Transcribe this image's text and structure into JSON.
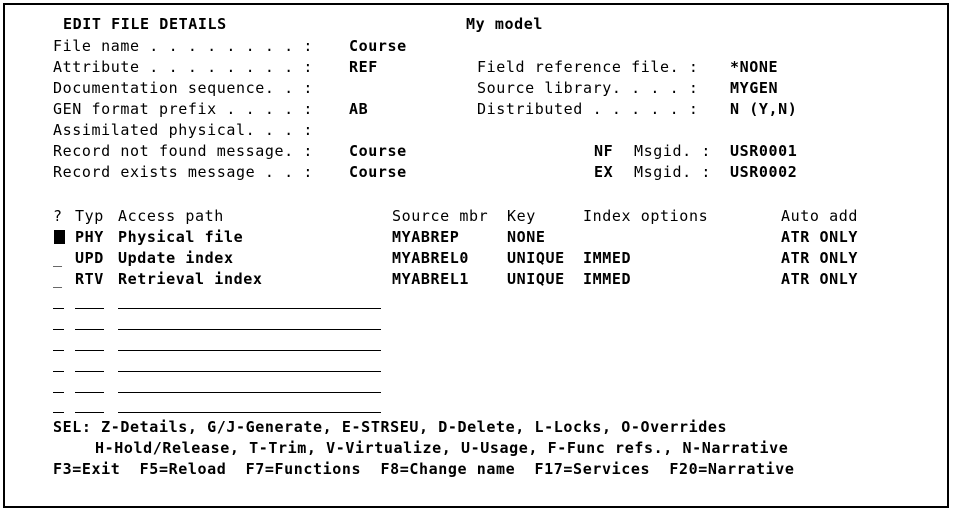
{
  "header": {
    "title": "EDIT FILE DETAILS",
    "model": "My model"
  },
  "fields": {
    "file_name": {
      "label": "File name . . . . . . . . :",
      "value": "Course"
    },
    "attribute": {
      "label": "Attribute . . . . . . . . :",
      "value": "REF"
    },
    "documentation_sequence": {
      "label": "Documentation sequence. . :",
      "value": ""
    },
    "gen_format_prefix": {
      "label": "GEN format prefix . . . . :",
      "value": "AB"
    },
    "assimilated_physical": {
      "label": "Assimilated physical. . . :",
      "value": ""
    },
    "record_not_found": {
      "label": "Record not found message. :",
      "value": "Course"
    },
    "record_exists": {
      "label": "Record exists message . . :",
      "value": "Course"
    },
    "field_reference_file": {
      "label": "Field reference file. :",
      "value": "*NONE"
    },
    "source_library": {
      "label": "Source library. . . . :",
      "value": "MYGEN"
    },
    "distributed": {
      "label": "Distributed . . . . . :",
      "value": "N (Y,N)"
    },
    "nf_msgid": {
      "code": "NF",
      "label": "Msgid. :",
      "value": "USR0001"
    },
    "ex_msgid": {
      "code": "EX",
      "label": "Msgid. :",
      "value": "USR0002"
    }
  },
  "table": {
    "headers": {
      "sel": "?",
      "typ": "Typ",
      "access_path": "Access path",
      "source_mbr": "Source mbr",
      "key": "Key",
      "index_options": "Index options",
      "auto_add": "Auto add"
    },
    "rows": [
      {
        "sel": "",
        "typ": "PHY",
        "access_path": "Physical file",
        "source_mbr": "MYABREP",
        "key": "NONE",
        "index_options": "",
        "auto_add": "ATR ONLY"
      },
      {
        "sel": "_",
        "typ": "UPD",
        "access_path": "Update index",
        "source_mbr": "MYABREL0",
        "key": "UNIQUE",
        "index_options": "IMMED",
        "auto_add": "ATR ONLY"
      },
      {
        "sel": "_",
        "typ": "RTV",
        "access_path": "Retrieval index",
        "source_mbr": "MYABREL1",
        "key": "UNIQUE",
        "index_options": "IMMED",
        "auto_add": "ATR ONLY"
      }
    ]
  },
  "footer": {
    "sel_line1": "SEL: Z-Details, G/J-Generate, E-STRSEU, D-Delete, L-Locks, O-Overrides",
    "sel_line2": "H-Hold/Release, T-Trim, V-Virtualize, U-Usage, F-Func refs., N-Narrative",
    "fkeys": "F3=Exit  F5=Reload  F7=Functions  F8=Change name  F17=Services  F20=Narrative"
  }
}
